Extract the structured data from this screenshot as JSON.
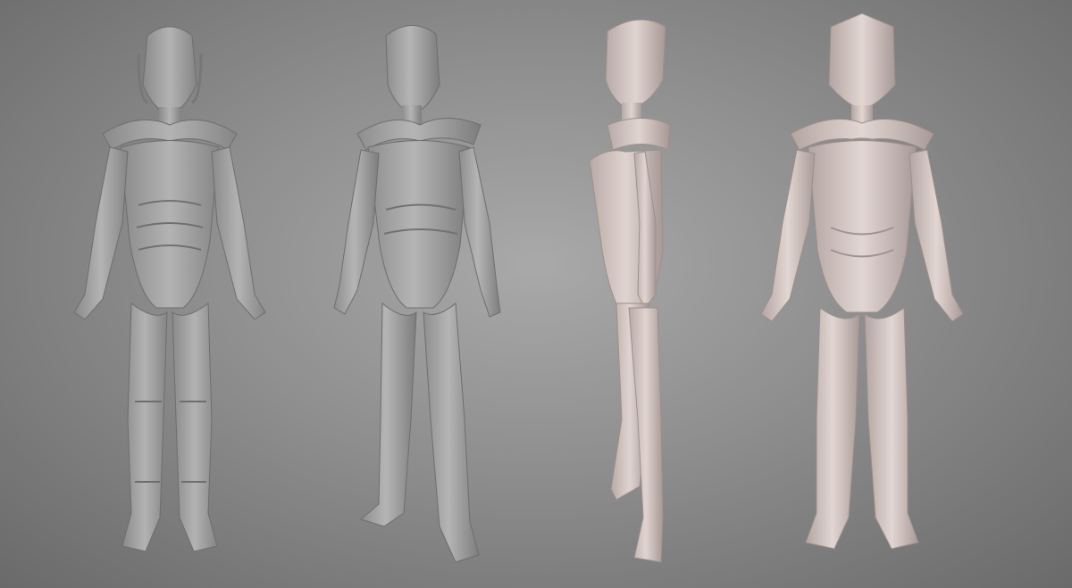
{
  "scene": {
    "background": "#8e8e8e",
    "views": [
      {
        "id": "front",
        "tone": "#a8a8a8",
        "shade": "#7f7f7f"
      },
      {
        "id": "three-quarter",
        "tone": "#a9a9a9",
        "shade": "#808080"
      },
      {
        "id": "side",
        "tone": "#d3c6c3",
        "shade": "#a89a97"
      },
      {
        "id": "back",
        "tone": "#d5c9c6",
        "shade": "#aa9d9a"
      }
    ]
  }
}
